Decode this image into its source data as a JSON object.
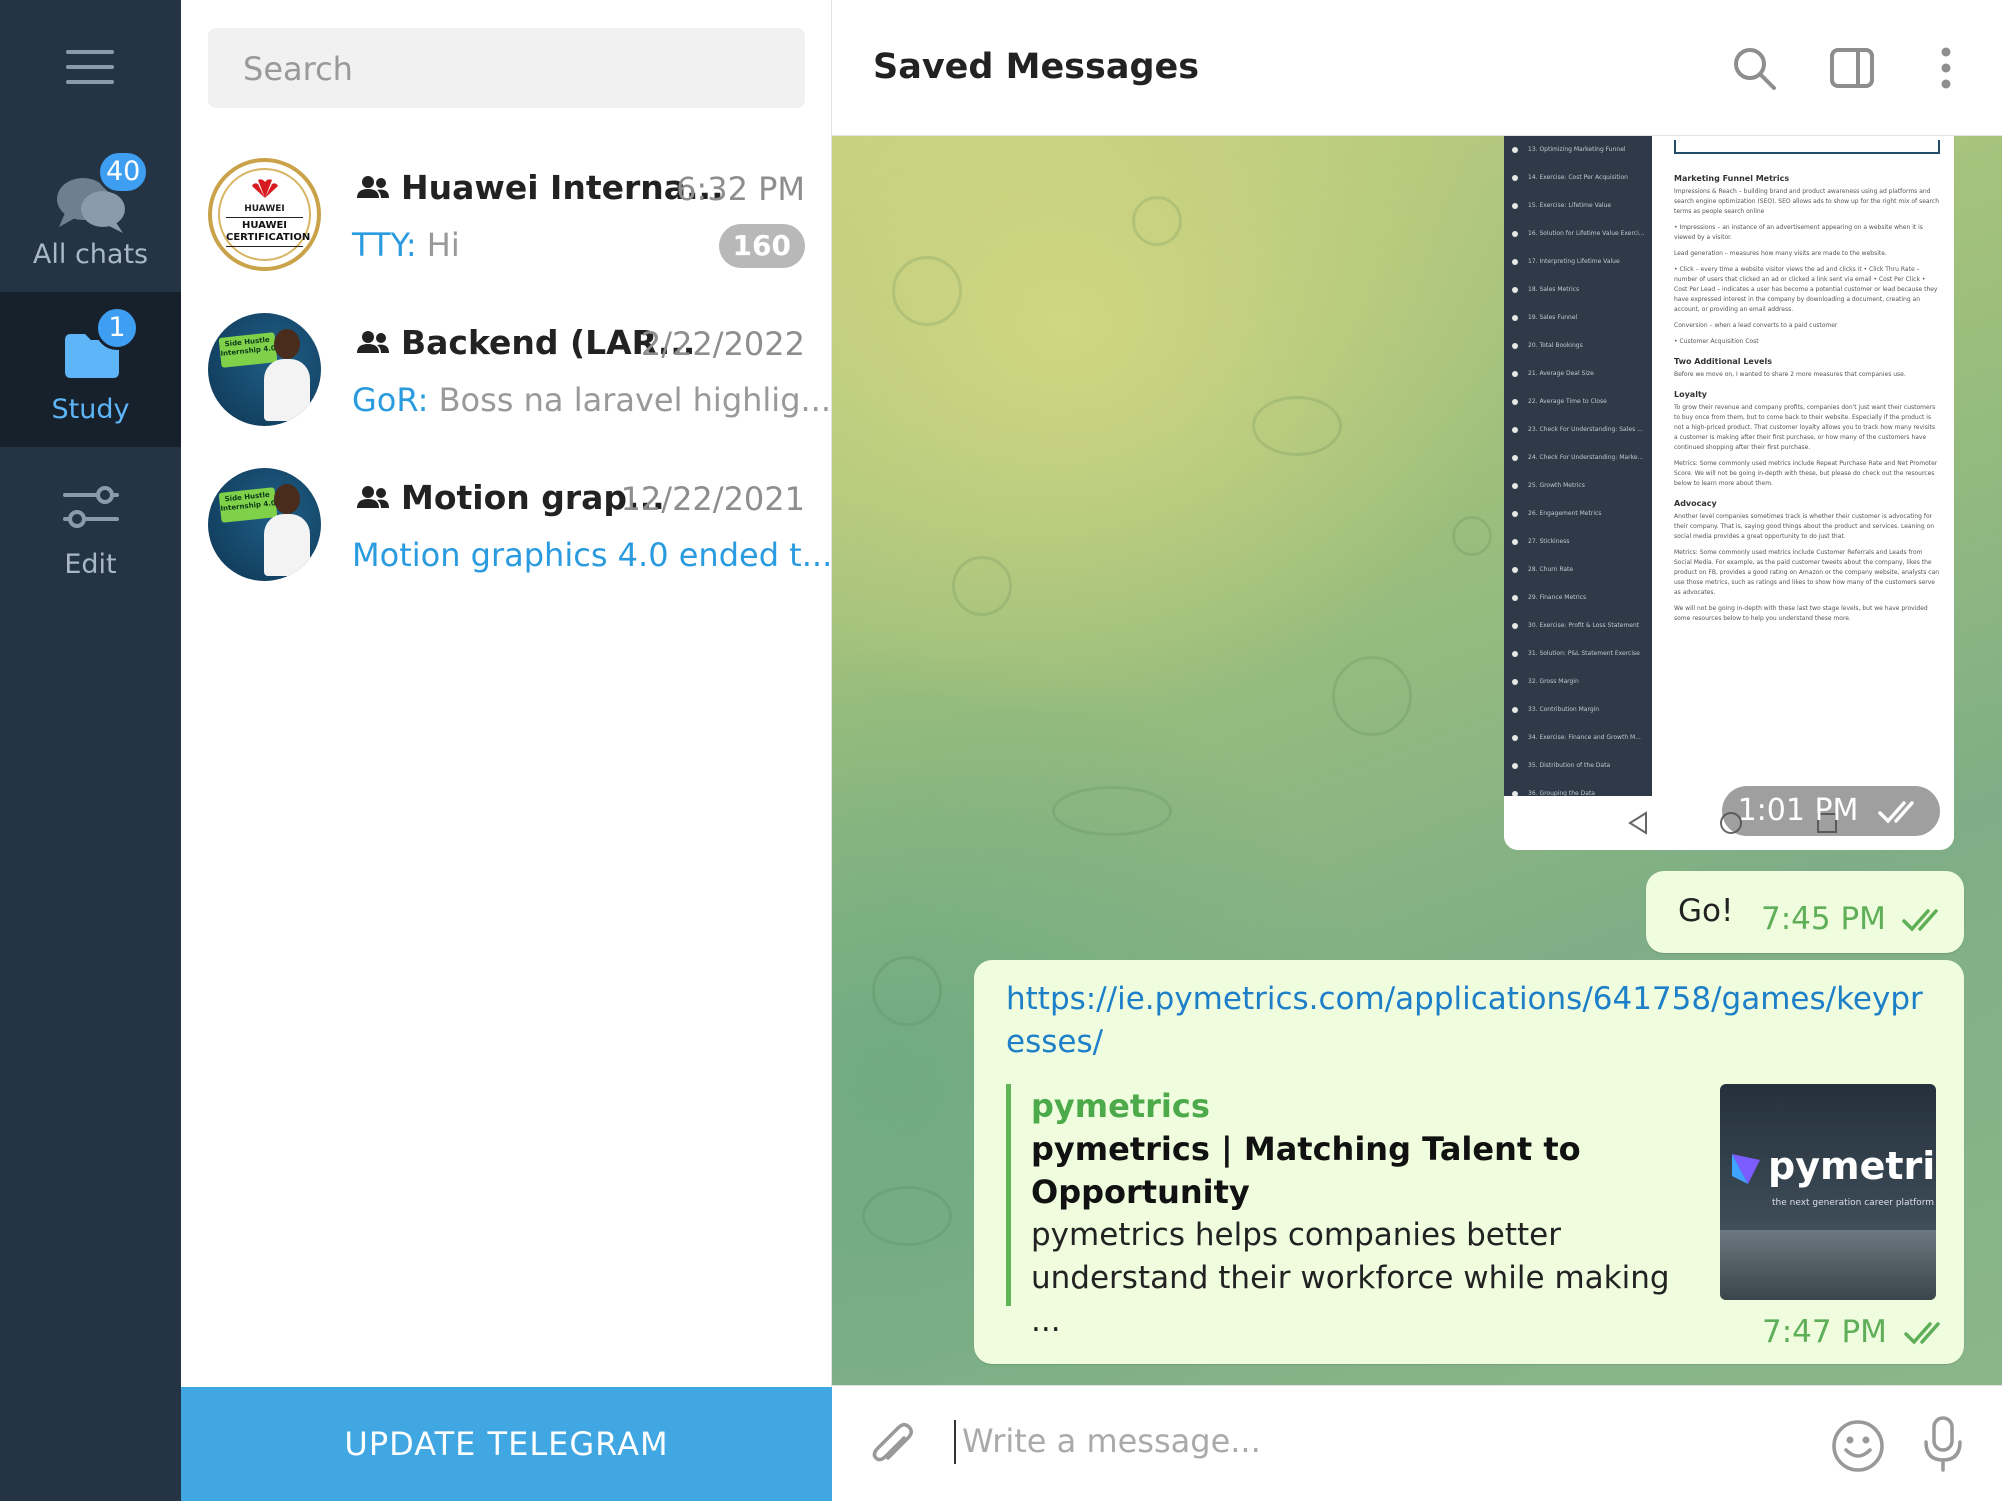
{
  "rail": {
    "folders": [
      {
        "label": "All chats",
        "badge": "40"
      },
      {
        "label": "Study",
        "badge": "1"
      },
      {
        "label": "Edit"
      }
    ]
  },
  "search": {
    "placeholder": "Search"
  },
  "chats": [
    {
      "name": "Huawei Interna...",
      "time": "6:32 PM",
      "sender": "TTY:",
      "preview": " Hi",
      "unread": "160",
      "avatar_text": [
        "HUAWEI",
        "HUAWEI CERTIFICATION"
      ]
    },
    {
      "name": "Backend (LAR...",
      "time": "2/22/2022",
      "sender": "GoR:",
      "preview": " Boss na laravel highlig...",
      "avatar_text": [
        "Side Hustle Internship 4.0"
      ]
    },
    {
      "name": "Motion grap...",
      "time": "12/22/2021",
      "preview": "Motion graphics 4.0 ended t...",
      "avatar_text": [
        "Side Hustle Internship 4.0"
      ]
    }
  ],
  "update_button": "UPDATE TELEGRAM",
  "header": {
    "title": "Saved Messages"
  },
  "messages": {
    "screenshot": {
      "time": "1:01 PM",
      "sidebar_items": [
        "13. Optimizing Marketing Funnel",
        "14. Exercise: Cost Per Acquisition",
        "15. Exercise: Lifetime Value",
        "16. Solution for Lifetime Value Exerci...",
        "17. Interpreting Lifetime Value",
        "18. Sales Metrics",
        "19. Sales Funnel",
        "20. Total Bookings",
        "21. Average Deal Size",
        "22. Average Time to Close",
        "23. Check For Understanding: Sales ...",
        "24. Check For Understanding: Marke...",
        "25. Growth Metrics",
        "26. Engagement Metrics",
        "27. Stickiness",
        "28. Churn Rate",
        "29. Finance Metrics",
        "30. Exercise: Profit & Loss Statement",
        "31. Solution: P&L Statement Exercise",
        "32. Gross Margin",
        "33. Contribution Margin",
        "34. Exercise: Finance and Growth M...",
        "35. Distribution of the Data",
        "36. Grouping the Data"
      ],
      "doc": {
        "h1": "Marketing Funnel Metrics",
        "p1": "Impressions & Reach – building brand and product awareness using ad platforms and search engine optimization (SEO). SEO allows ads to show up for the right mix of search terms as people search online",
        "p2": "• Impressions – an instance of an advertisement appearing on a website when it is viewed by a visitor.",
        "p3": "Lead generation – measures how many visits are made to the website.",
        "p4": "• Click – every time a website visitor views the ad and clicks it • Click Thru Rate – number of users that clicked an ad or clicked a link sent via email • Cost Per Click • Cost Per Lead – indicates a user has become a potential customer or lead because they have expressed interest in the company by downloading a document, creating an account, or providing an email address.",
        "p5": "Conversion – when a lead converts to a paid customer",
        "p6": "• Customer Acquisition Cost",
        "h2": "Two Additional Levels",
        "p7": "Before we move on, I wanted to share 2 more measures that companies use.",
        "h3": "Loyalty",
        "p8": "To grow their revenue and company profits, companies don't just want their customers to buy once from them, but to come back to their website. Especially if the product is not a high-priced product. That customer loyalty allows you to track how many revisits a customer is making after their first purchase, or how many of the customers have continued shopping after their first purchase.",
        "p9": "Metrics: Some commonly used metrics include Repeat Purchase Rate and Net Promoter Score. We will not be going in-depth with these, but please do check out the resources below to learn more about them.",
        "h4": "Advocacy",
        "p10": "Another level companies sometimes track is whether their customer is advocating for their company. That is, saying good things about the product and services. Leaning on social media provides a great opportunity to do just that.",
        "p11": "Metrics: Some commonly used metrics include Customer Referrals and Leads from Social Media. For example, as the paid customer tweets about the company, likes the product on FB, provides a good rating on Amazon or the company website, analysts can use those metrics, such as ratings and likes to show how many of the customers serve as advocates.",
        "p12": "We will not be going in-depth with these last two stage levels, but we have provided some resources below to help you understand these more."
      }
    },
    "text": {
      "body": "Go!",
      "time": "7:45 PM"
    },
    "link": {
      "url": "https://ie.pymetrics.com/applications/641758/games/keypresses/",
      "site": "pymetrics",
      "title": "pymetrics | Matching Talent to Opportunity",
      "description": "pymetrics helps companies better understand their workforce while making ...",
      "thumb_brand": "pymetric",
      "thumb_tagline": "the next generation career platform",
      "time": "7:47 PM"
    }
  },
  "composer": {
    "placeholder": "Write a message..."
  },
  "colors": {
    "accent": "#40a7e3",
    "rail": "#253444",
    "outgoing_bubble": "#effdde",
    "read_check": "#5fae58"
  }
}
